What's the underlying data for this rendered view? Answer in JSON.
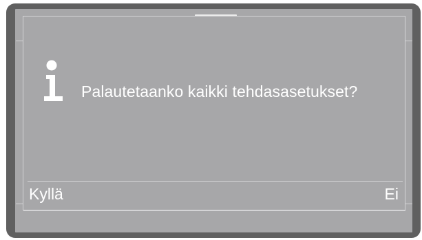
{
  "dialog": {
    "icon": "info-icon",
    "message": "Palautetaanko kaikki tehdasasetukset?"
  },
  "softkeys": {
    "left_label": "Kyllä",
    "right_label": "Ei"
  },
  "colors": {
    "bezel": "#606060",
    "screen": "#a7a7a9",
    "text": "#ffffff",
    "lines": "#d4d4d6"
  }
}
